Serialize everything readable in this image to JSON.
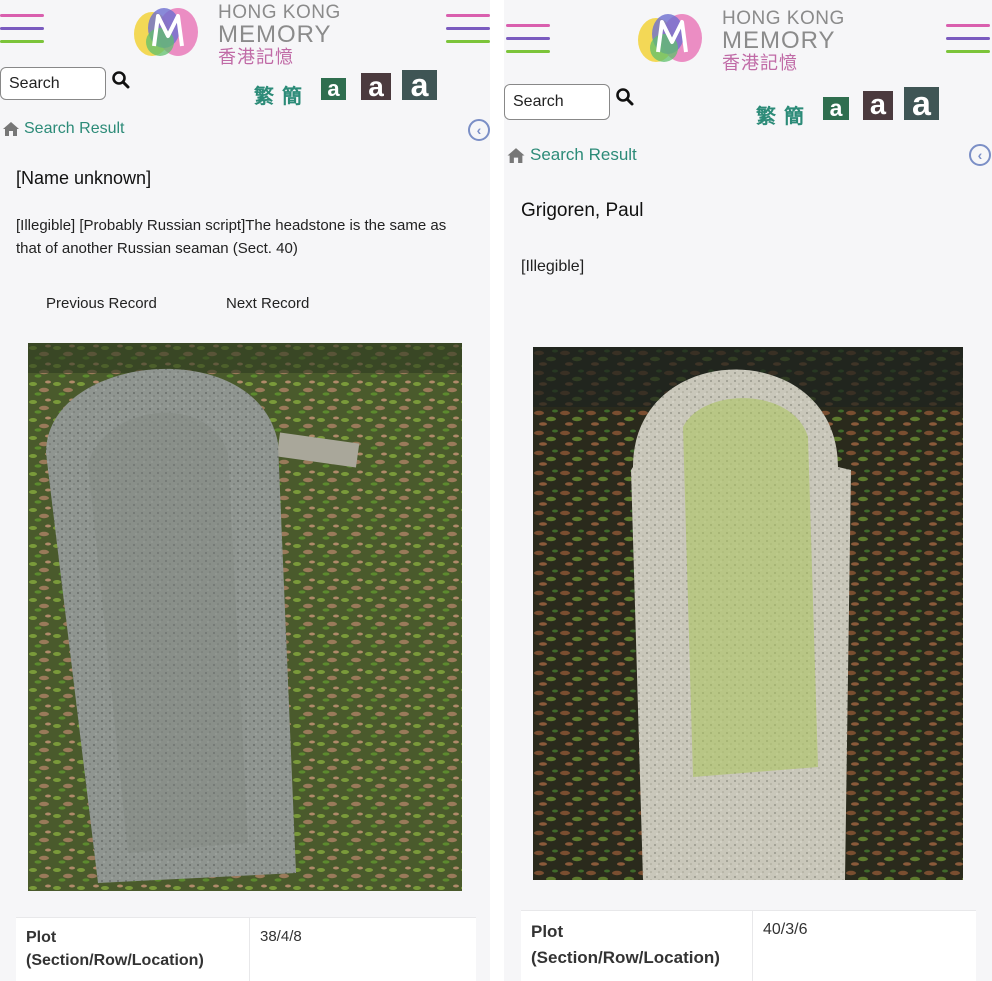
{
  "site": {
    "logo_line1": "HONG KONG",
    "logo_line2": "MEMORY",
    "logo_zh": "香港記憶",
    "brand_colors": {
      "pink": "#d95fae",
      "purple": "#7a5bbf",
      "green": "#7cc43a",
      "teal": "#2c8b78"
    }
  },
  "toolbar": {
    "search_placeholder": "Search",
    "lang_traditional": "繁",
    "lang_simplified": "簡",
    "font_small": "a",
    "font_medium": "a",
    "font_large": "a"
  },
  "breadcrumb": {
    "label": "Search Result"
  },
  "records": [
    {
      "title": "[Name unknown]",
      "description": "[Illegible] [Probably Russian script]The headstone is the same as that of another Russian seaman (Sect. 40)",
      "prev_label": "Previous Record",
      "next_label": "Next Record",
      "photo_alt": "headstone-photo",
      "plot_label_1": "Plot",
      "plot_label_2": "(Section/Row/Location)",
      "plot_value": "38/4/8"
    },
    {
      "title": "Grigoren, Paul",
      "description": "[Illegible]",
      "photo_alt": "headstone-photo",
      "plot_label_1": "Plot",
      "plot_label_2": "(Section/Row/Location)",
      "plot_value": "40/3/6"
    }
  ]
}
